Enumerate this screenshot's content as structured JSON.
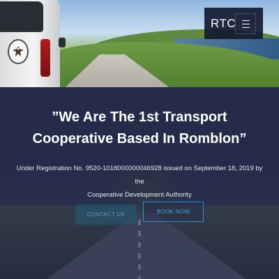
{
  "nav": {
    "brand": "RTC",
    "menu_icon": "hamburger-icon"
  },
  "hero": {
    "headline_line1": "”We Are The 1st Transport",
    "headline_line2": "Cooperative Based In Romblon”",
    "subtext_line1": "Under Registration No. 9520-1018000000046928 issued on September 18, 2019 by the",
    "subtext_line2": "Cooperative Development Authority",
    "buttons": {
      "contact_label": "CONTACT US",
      "book_label": "BOOK NOW"
    }
  },
  "colors": {
    "nav_bg": "#121a30",
    "hero_overlay": "#1e2446",
    "button_accent": "#2e8fcf",
    "contact_bg": "#225c78"
  },
  "photo": {
    "emblem_icon": "eagle-emblem-icon"
  }
}
